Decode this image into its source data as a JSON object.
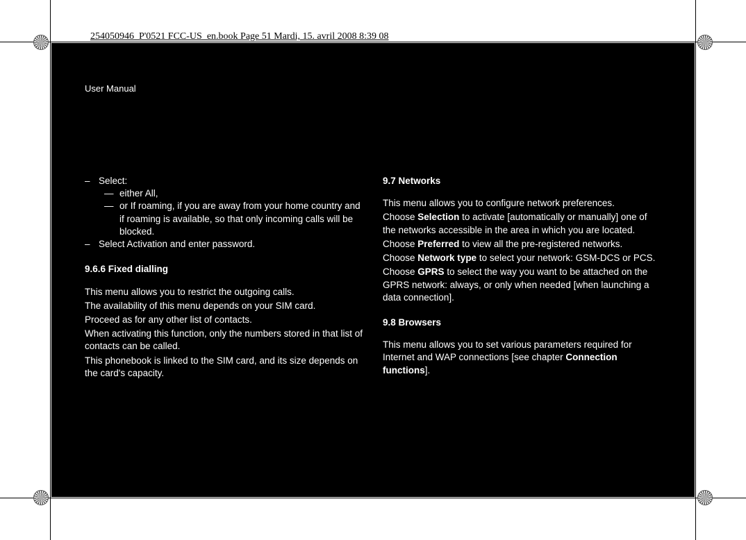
{
  "imprint": "254050946_P'0521 FCC-US_en.book  Page 51  Mardi, 15. avril 2008  8:39 08",
  "header": "User Manual",
  "left": {
    "b1": "Select:",
    "b1a": "either All,",
    "b1b": "or If roaming, if you are away from your home country and if roaming is available, so that only incoming calls will be blocked.",
    "b2": "Select Activation and enter password.",
    "h966": "9.6.6 Fixed dialling",
    "p1": "This menu allows you to restrict the outgoing calls.",
    "p2": "The availability of this menu depends on your SIM card.",
    "p3": "Proceed as for any other list of contacts.",
    "p4": "When activating this function, only the numbers stored in that list of contacts can be called.",
    "p5": "This phonebook is linked to the SIM card, and its size depends on the card's capacity."
  },
  "right": {
    "h97": "9.7 Networks",
    "p1": "This menu allows you to configure network preferences.",
    "p2a": "Choose ",
    "p2b": "Selection",
    "p2c": " to activate [automatically or manually] one of the networks accessible in the area in which you are located.",
    "p3a": "Choose ",
    "p3b": "Preferred",
    "p3c": " to view all the pre-registered networks.",
    "p4a": "Choose ",
    "p4b": "Network type",
    "p4c": " to select your network: GSM-DCS or PCS.",
    "p5a": "Choose ",
    "p5b": "GPRS",
    "p5c": " to select the way you want to be attached on the GPRS network: always, or only when needed [when launching a data connection].",
    "h98": "9.8 Browsers",
    "p6a": "This menu allows you to set various parameters required for Internet and WAP connections [see chapter ",
    "p6b": "Connection functions",
    "p6c": "]."
  }
}
